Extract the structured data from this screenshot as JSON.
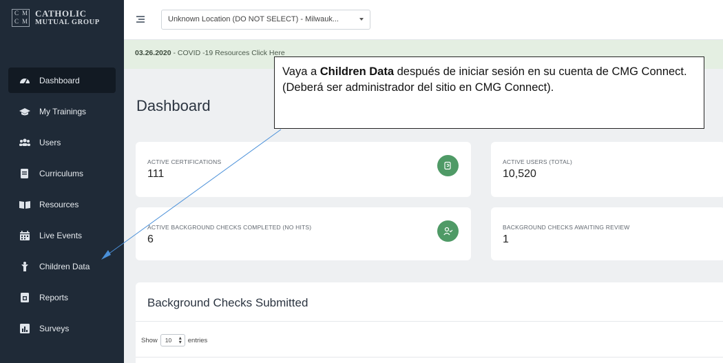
{
  "sidebar": {
    "logo": {
      "line1": "CATHOLIC",
      "line2": "MUTUAL GROUP",
      "mark": [
        "C",
        "M",
        "C",
        "M"
      ]
    },
    "items": [
      {
        "label": "Dashboard",
        "icon": "gauge-icon",
        "active": true
      },
      {
        "label": "My Trainings",
        "icon": "graduation-cap-icon"
      },
      {
        "label": "Users",
        "icon": "users-icon"
      },
      {
        "label": "Curriculums",
        "icon": "document-icon"
      },
      {
        "label": "Resources",
        "icon": "book-icon"
      },
      {
        "label": "Live Events",
        "icon": "calendar-icon"
      },
      {
        "label": "Children Data",
        "icon": "child-icon"
      },
      {
        "label": "Reports",
        "icon": "report-icon"
      },
      {
        "label": "Surveys",
        "icon": "bar-chart-icon"
      }
    ]
  },
  "topbar": {
    "location_value": "Unknown Location (DO NOT SELECT) - Milwauk..."
  },
  "banner": {
    "date": "03.26.2020",
    "text": " - COVID -19 Resources Click Here"
  },
  "page": {
    "title": "Dashboard"
  },
  "cards": {
    "active_certifications": {
      "label": "ACTIVE CERTIFICATIONS",
      "value": "111"
    },
    "active_users": {
      "label": "ACTIVE USERS (TOTAL)",
      "value": "10,520"
    },
    "bg_completed": {
      "label": "ACTIVE BACKGROUND CHECKS COMPLETED (NO HITS)",
      "value": "6"
    },
    "bg_awaiting": {
      "label": "BACKGROUND CHECKS AWAITING REVIEW",
      "value": "1"
    }
  },
  "panel": {
    "title": "Background Checks Submitted",
    "show_label": "Show",
    "page_length": "10",
    "entries_label": "entries"
  },
  "callout": {
    "part1": "Vaya a ",
    "bold": "Children Data",
    "part2": " después de iniciar sesión en su cuenta de CMG Connect. (Deberá ser administrador del sitio en CMG Connect)."
  },
  "colors": {
    "sidebar": "#1f2a37",
    "accent_green": "#4f9a66",
    "banner": "#e4efe2",
    "arrow": "#4a90d9"
  }
}
